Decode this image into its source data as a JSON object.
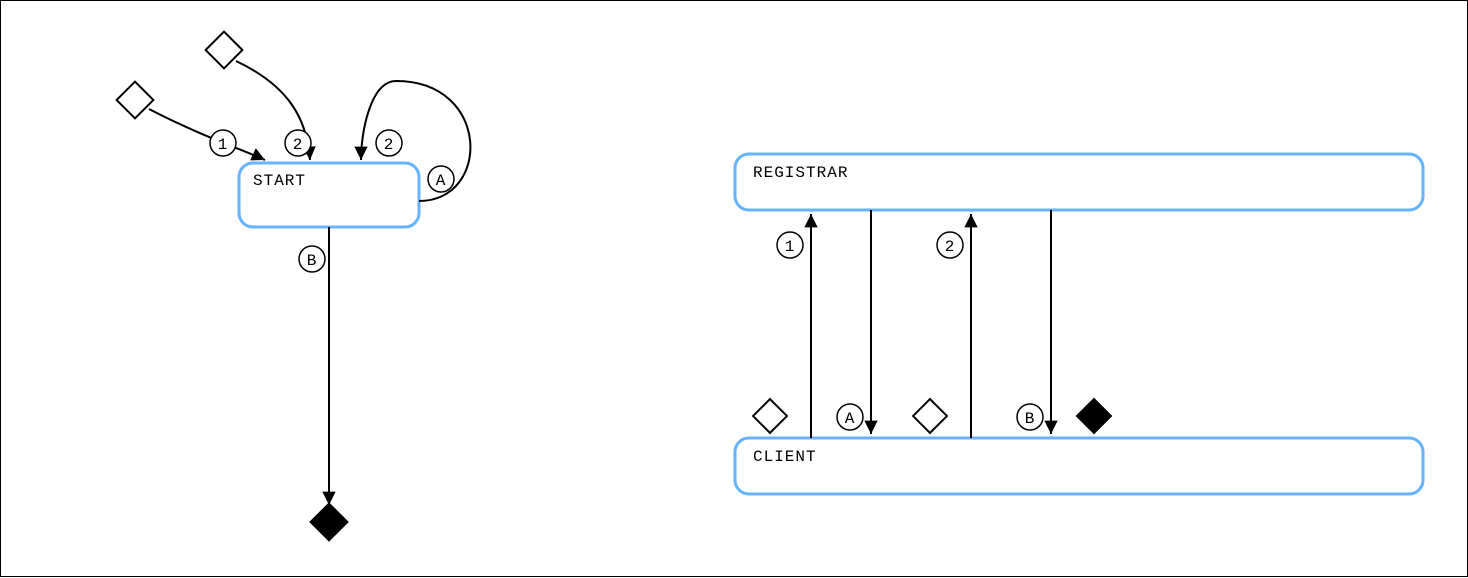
{
  "left": {
    "node_label": "START",
    "edge_labels": {
      "in1": "1",
      "in2": "2",
      "loop": "2",
      "loop_side": "A",
      "out": "B"
    }
  },
  "right": {
    "top_box": "REGISTRAR",
    "bottom_box": "CLIENT",
    "edge_labels": {
      "up1": "1",
      "downA": "A",
      "up2": "2",
      "downB": "B"
    }
  }
}
